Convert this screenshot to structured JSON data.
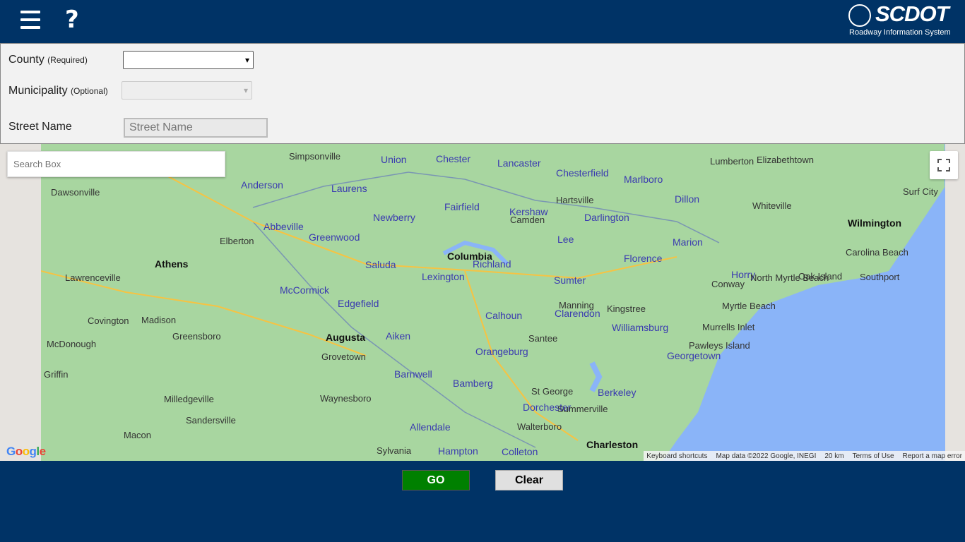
{
  "header": {
    "logo_text": "SCDOT",
    "logo_subtitle": "Roadway Information System",
    "help_label": "?"
  },
  "form": {
    "county_label": "County",
    "county_hint": "(Required)",
    "county_value": "",
    "municipality_label": "Municipality",
    "municipality_hint": "(Optional)",
    "municipality_value": "",
    "street_label": "Street Name",
    "street_placeholder": "Street Name"
  },
  "map": {
    "search_placeholder": "Search Box",
    "labels": [
      {
        "text": "Union",
        "cls": "county"
      },
      {
        "text": "Chester",
        "cls": "county"
      },
      {
        "text": "Lancaster",
        "cls": "county"
      },
      {
        "text": "Chesterfield",
        "cls": "county"
      },
      {
        "text": "Marlboro",
        "cls": "county"
      },
      {
        "text": "Dillon",
        "cls": "county"
      },
      {
        "text": "Laurens",
        "cls": "county"
      },
      {
        "text": "Fairfield",
        "cls": "county"
      },
      {
        "text": "Kershaw",
        "cls": "county"
      },
      {
        "text": "Darlington",
        "cls": "county"
      },
      {
        "text": "Newberry",
        "cls": "county"
      },
      {
        "text": "Abbeville",
        "cls": "county"
      },
      {
        "text": "Greenwood",
        "cls": "county"
      },
      {
        "text": "Lee",
        "cls": "county"
      },
      {
        "text": "Marion",
        "cls": "county"
      },
      {
        "text": "Columbia",
        "cls": "bold"
      },
      {
        "text": "Richland",
        "cls": "county"
      },
      {
        "text": "Saluda",
        "cls": "county"
      },
      {
        "text": "Lexington",
        "cls": "county"
      },
      {
        "text": "Florence",
        "cls": "county"
      },
      {
        "text": "Horry",
        "cls": "county"
      },
      {
        "text": "Sumter",
        "cls": "county"
      },
      {
        "text": "McCormick",
        "cls": "county"
      },
      {
        "text": "Edgefield",
        "cls": "county"
      },
      {
        "text": "Calhoun",
        "cls": "county"
      },
      {
        "text": "Clarendon",
        "cls": "county"
      },
      {
        "text": "Williamsburg",
        "cls": "county"
      },
      {
        "text": "Augusta",
        "cls": "bold"
      },
      {
        "text": "Aiken",
        "cls": "county"
      },
      {
        "text": "Orangeburg",
        "cls": "county"
      },
      {
        "text": "Georgetown",
        "cls": "county"
      },
      {
        "text": "Barnwell",
        "cls": "county"
      },
      {
        "text": "Bamberg",
        "cls": "county"
      },
      {
        "text": "Berkeley",
        "cls": "county"
      },
      {
        "text": "Dorchester",
        "cls": "county"
      },
      {
        "text": "Allendale",
        "cls": "county"
      },
      {
        "text": "Hampton",
        "cls": "county"
      },
      {
        "text": "Colleton",
        "cls": "county"
      },
      {
        "text": "Charleston",
        "cls": "bold"
      },
      {
        "text": "Athens",
        "cls": "bold"
      },
      {
        "text": "Wilmington",
        "cls": "bold"
      },
      {
        "text": "Myrtle Beach",
        "cls": ""
      },
      {
        "text": "Lumberton",
        "cls": ""
      },
      {
        "text": "Elizabethtown",
        "cls": ""
      },
      {
        "text": "Whiteville",
        "cls": ""
      },
      {
        "text": "Carolina Beach",
        "cls": ""
      },
      {
        "text": "Southport",
        "cls": ""
      },
      {
        "text": "Oak Island",
        "cls": ""
      },
      {
        "text": "Conway",
        "cls": ""
      },
      {
        "text": "Pawleys Island",
        "cls": ""
      },
      {
        "text": "Murrells Inlet",
        "cls": ""
      },
      {
        "text": "Kingstree",
        "cls": ""
      },
      {
        "text": "Santee",
        "cls": ""
      },
      {
        "text": "Summerville",
        "cls": ""
      },
      {
        "text": "St George",
        "cls": ""
      },
      {
        "text": "Walterboro",
        "cls": ""
      },
      {
        "text": "Sylvania",
        "cls": ""
      },
      {
        "text": "Waynesboro",
        "cls": ""
      },
      {
        "text": "Grovetown",
        "cls": ""
      },
      {
        "text": "Milledgeville",
        "cls": ""
      },
      {
        "text": "Sandersville",
        "cls": ""
      },
      {
        "text": "Macon",
        "cls": ""
      },
      {
        "text": "Madison",
        "cls": ""
      },
      {
        "text": "Greensboro",
        "cls": ""
      },
      {
        "text": "Covington",
        "cls": ""
      },
      {
        "text": "McDonough",
        "cls": ""
      },
      {
        "text": "Lawrenceville",
        "cls": ""
      },
      {
        "text": "Elberton",
        "cls": ""
      },
      {
        "text": "Dawsonville",
        "cls": ""
      },
      {
        "text": "Anderson",
        "cls": "county"
      },
      {
        "text": "Simpsonville",
        "cls": ""
      },
      {
        "text": "Surf City",
        "cls": ""
      },
      {
        "text": "Hartsville",
        "cls": ""
      },
      {
        "text": "Camden",
        "cls": ""
      },
      {
        "text": "Manning",
        "cls": ""
      },
      {
        "text": "North Myrtle Beach",
        "cls": ""
      },
      {
        "text": "Griffin",
        "cls": ""
      }
    ],
    "google_label": "Google",
    "attribution": [
      "Keyboard shortcuts",
      "Map data ©2022 Google, INEGI",
      "20 km",
      "Terms of Use",
      "Report a map error"
    ]
  },
  "buttons": {
    "go": "GO",
    "clear": "Clear"
  }
}
